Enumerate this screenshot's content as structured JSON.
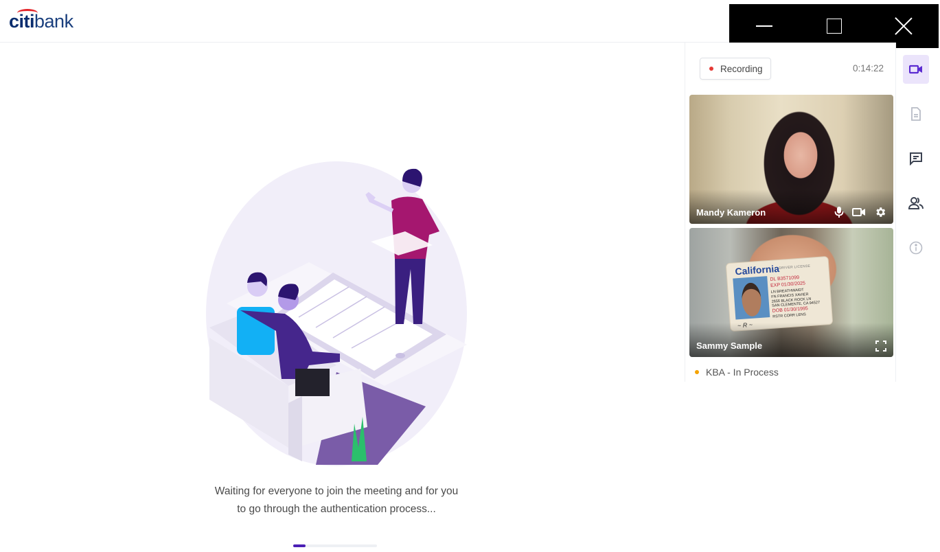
{
  "brand": {
    "part1": "citi",
    "part2": "bank",
    "arc_color": "#e3262b",
    "color": "#0a2d6e"
  },
  "window_controls": {
    "minimize": "minimize-icon",
    "maximize": "maximize-icon",
    "close": "close-icon"
  },
  "main": {
    "message_line1": "Waiting for everyone to join the meeting and for you",
    "message_line2": "to go through the authentication process...",
    "progress_percent": 15,
    "accent": "#4b1fb5"
  },
  "panel": {
    "recording_label": "Recording",
    "recording_dot_color": "#e53935",
    "timer": "0:14:22",
    "participants": [
      {
        "name": "Mandy Kameron",
        "controls": [
          "microphone-icon",
          "camera-icon",
          "settings-icon"
        ]
      },
      {
        "name": "Sammy Sample",
        "controls": [
          "fullscreen-icon"
        ],
        "id_card": {
          "state": "California",
          "type": "DRIVER LICENSE",
          "dl": "DL B3571099",
          "exp": "EXP 01/30/2025",
          "ln": "LN BREATHWAIDT",
          "fn": "FN FRANCIS XAVIER",
          "addr1": "2656 BLACK ROCK LN",
          "addr2": "SAN CLEMENTE, CA 94527",
          "dob": "DOB 01/30/1995",
          "rstr": "RSTR CORR LENS"
        }
      }
    ],
    "status": {
      "label": "KBA - In Process",
      "dot_color": "#f5a300"
    }
  },
  "rail": {
    "items": [
      {
        "name": "video",
        "icon": "video-camera-icon",
        "active": true
      },
      {
        "name": "documents",
        "icon": "document-icon",
        "active": false
      },
      {
        "name": "chat",
        "icon": "chat-icon",
        "active": false
      },
      {
        "name": "participants",
        "icon": "people-icon",
        "active": false
      },
      {
        "name": "info",
        "icon": "info-icon",
        "active": false
      }
    ],
    "active_color": "#5b2bd1"
  }
}
